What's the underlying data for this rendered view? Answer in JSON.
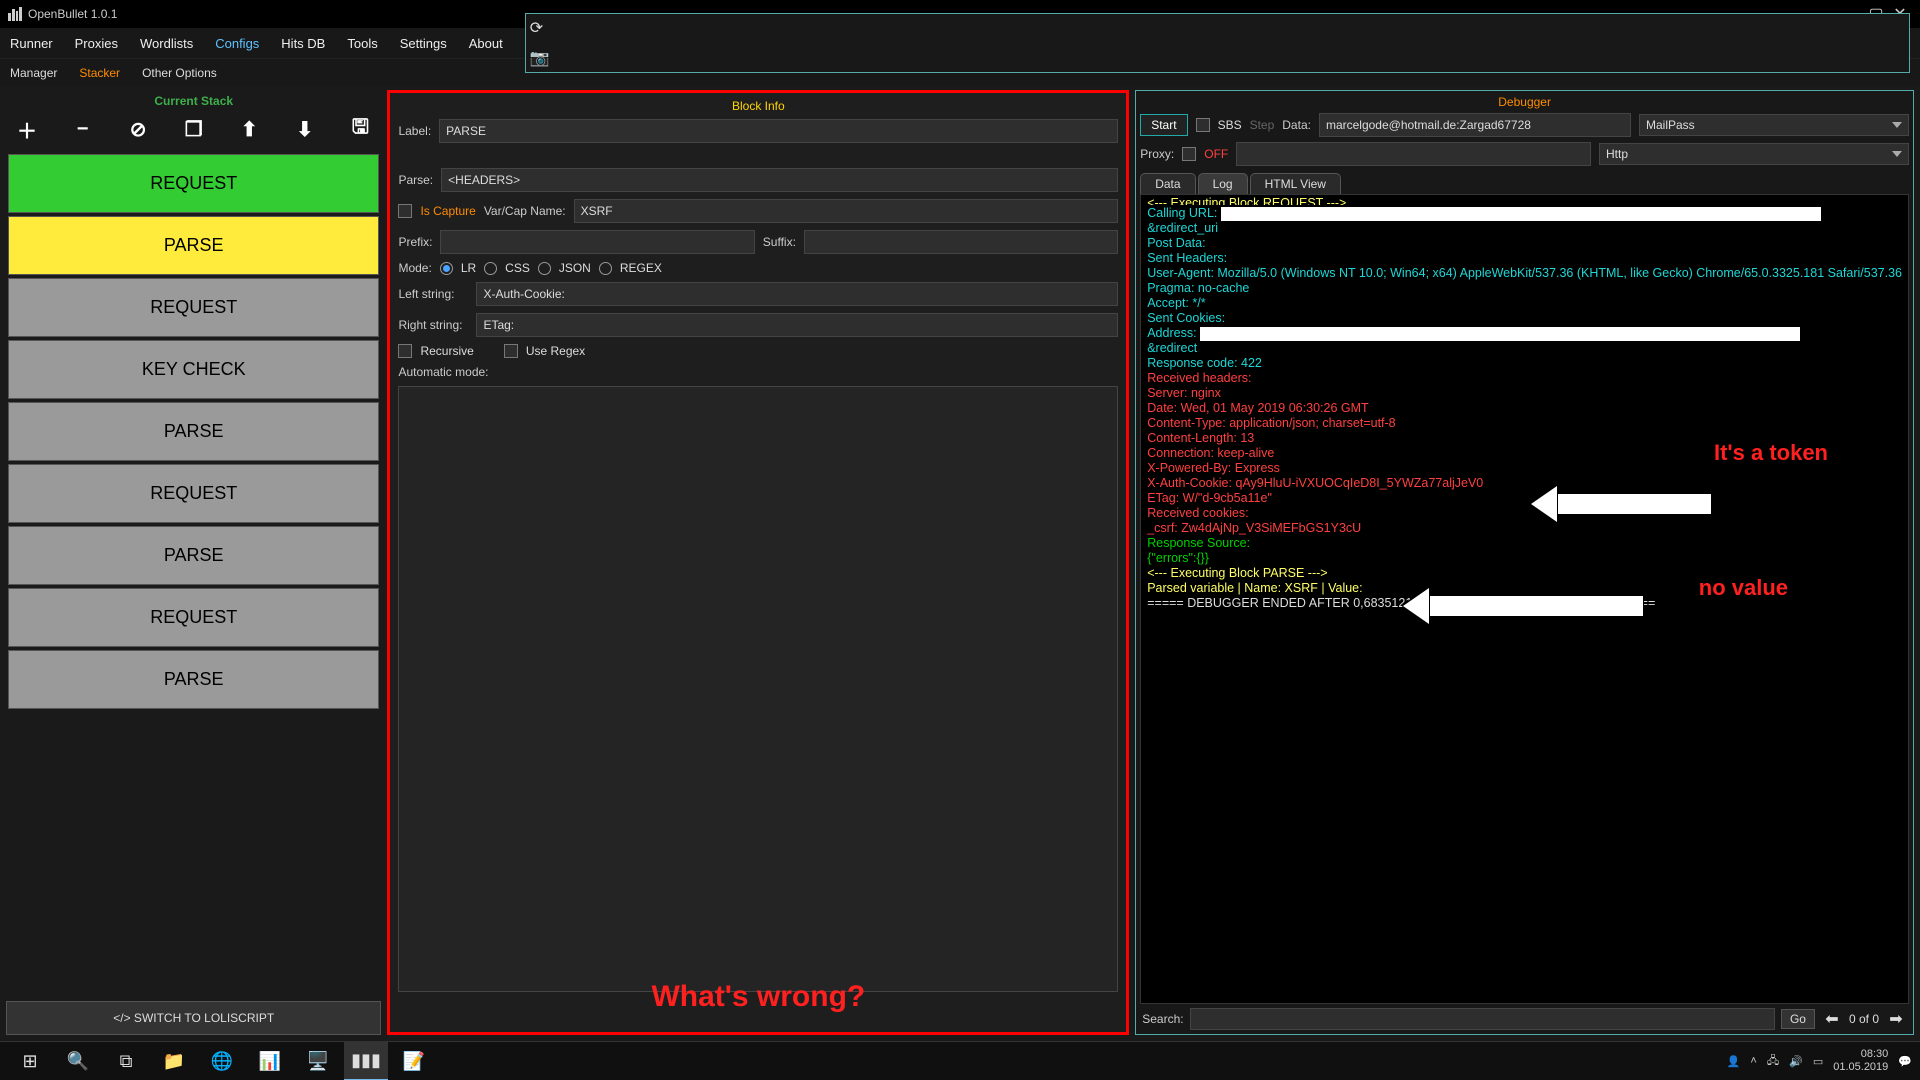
{
  "app": {
    "title": "OpenBullet 1.0.1"
  },
  "menu": {
    "items": [
      "Runner",
      "Proxies",
      "Wordlists",
      "Configs",
      "Hits DB",
      "Tools",
      "Settings",
      "About"
    ],
    "active": "Configs"
  },
  "submenu": {
    "items": [
      "Manager",
      "Stacker",
      "Other Options"
    ],
    "active": "Stacker"
  },
  "left": {
    "title": "Current Stack",
    "footer": "</> SWITCH TO LOLISCRIPT",
    "blocks": [
      {
        "label": "REQUEST",
        "color": "green"
      },
      {
        "label": "PARSE",
        "color": "yellow"
      },
      {
        "label": "REQUEST",
        "color": "gray"
      },
      {
        "label": "KEY CHECK",
        "color": "gray"
      },
      {
        "label": "PARSE",
        "color": "gray"
      },
      {
        "label": "REQUEST",
        "color": "gray"
      },
      {
        "label": "PARSE",
        "color": "gray"
      },
      {
        "label": "REQUEST",
        "color": "gray"
      },
      {
        "label": "PARSE",
        "color": "gray"
      }
    ]
  },
  "block": {
    "title": "Block Info",
    "label_label": "Label:",
    "label_value": "PARSE",
    "parse_label": "Parse:",
    "parse_value": "<HEADERS>",
    "iscapture_label": "Is Capture",
    "varcap_label": "Var/Cap Name:",
    "varcap_value": "XSRF",
    "prefix_label": "Prefix:",
    "prefix_value": "",
    "suffix_label": "Suffix:",
    "suffix_value": "",
    "mode_label": "Mode:",
    "modes": [
      "LR",
      "CSS",
      "JSON",
      "REGEX"
    ],
    "mode_selected": "LR",
    "leftstr_label": "Left string:",
    "leftstr_value": "X-Auth-Cookie:",
    "rightstr_label": "Right string:",
    "rightstr_value": "ETag:",
    "recursive_label": "Recursive",
    "useregex_label": "Use Regex",
    "auto_label": "Automatic mode:",
    "annotation": "What's wrong?"
  },
  "debugger": {
    "title": "Debugger",
    "start": "Start",
    "sbs": "SBS",
    "step": "Step",
    "data_label": "Data:",
    "data_value": "marcelgode@hotmail.de:Zargad67728",
    "data_type": "MailPass",
    "proxy_label": "Proxy:",
    "proxy_off": "OFF",
    "proxy_value": "",
    "proxy_type": "Http",
    "tabs": [
      "Data",
      "Log",
      "HTML View"
    ],
    "tab_active": "Log",
    "log_lines": [
      {
        "cls": "yellow",
        "txt": "<--- Executing Block REQUEST --->",
        "cut": true
      },
      {
        "cls": "cyan",
        "txt": "Calling URL: ",
        "redact": 600
      },
      {
        "cls": "cyan",
        "txt": "&redirect_uri",
        "redact": 0
      },
      {
        "cls": "cyan",
        "txt": "Post Data: "
      },
      {
        "cls": "cyan",
        "txt": "Sent Headers:"
      },
      {
        "cls": "cyan",
        "txt": "User-Agent: Mozilla/5.0 (Windows NT 10.0; Win64; x64) AppleWebKit/537.36 (KHTML, like Gecko) Chrome/65.0.3325.181 Safari/537.36"
      },
      {
        "cls": "cyan",
        "txt": "Pragma: no-cache"
      },
      {
        "cls": "cyan",
        "txt": "Accept: */*"
      },
      {
        "cls": "cyan",
        "txt": "Sent Cookies: "
      },
      {
        "cls": "cyan",
        "txt": ""
      },
      {
        "cls": "cyan",
        "txt": "Address: ",
        "redact": 600
      },
      {
        "cls": "cyan",
        "txt": "&redirect",
        "redact": 0
      },
      {
        "cls": "cyan",
        "txt": "Response code: 422"
      },
      {
        "cls": "red",
        "txt": "Received headers:"
      },
      {
        "cls": "red",
        "txt": "Server: nginx"
      },
      {
        "cls": "red",
        "txt": "Date: Wed, 01 May 2019 06:30:26 GMT"
      },
      {
        "cls": "red",
        "txt": "Content-Type: application/json; charset=utf-8"
      },
      {
        "cls": "red",
        "txt": "Content-Length: 13"
      },
      {
        "cls": "red",
        "txt": "Connection: keep-alive"
      },
      {
        "cls": "red",
        "txt": "X-Powered-By: Express"
      },
      {
        "cls": "red",
        "txt": "X-Auth-Cookie: qAy9HluU-iVXUOCqIeD8I_5YWZa77aljJeV0"
      },
      {
        "cls": "red",
        "txt": "ETag: W/\"d-9cb5a11e\""
      },
      {
        "cls": "red",
        "txt": "Received cookies:"
      },
      {
        "cls": "red",
        "txt": "_csrf: Zw4dAjNp_V3SiMEFbGS1Y3cU"
      },
      {
        "cls": "green",
        "txt": "Response Source:"
      },
      {
        "cls": "green",
        "txt": "{\"errors\":{}}"
      },
      {
        "cls": "yellow",
        "txt": "<--- Executing Block PARSE --->"
      },
      {
        "cls": "yellow",
        "txt": "Parsed variable | Name: XSRF | Value: "
      },
      {
        "cls": "white",
        "txt": ""
      },
      {
        "cls": "white",
        "txt": "===== DEBUGGER ENDED AFTER 0,6835121 SECOND(S) WITH STATUS: NONE ====="
      }
    ],
    "annot1": "It's a token",
    "annot2": "no value",
    "search_label": "Search:",
    "go": "Go",
    "count": "0  of  0"
  },
  "taskbar": {
    "time": "08:30",
    "date": "01.05.2019"
  }
}
